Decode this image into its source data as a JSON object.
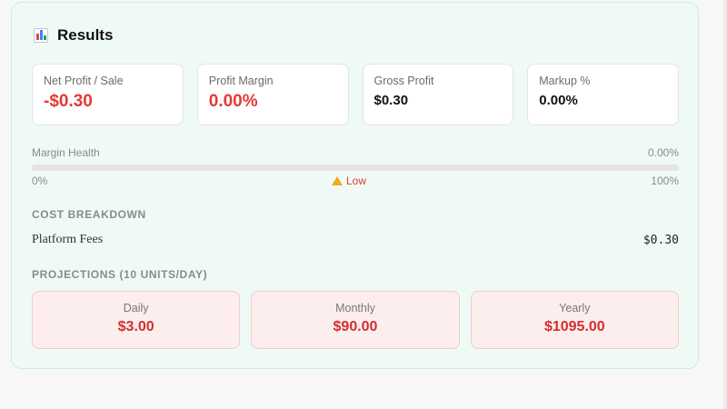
{
  "results": {
    "title": "Results",
    "header_icon": "bar-chart-icon"
  },
  "metrics": [
    {
      "label": "Net Profit / Sale",
      "value": "-$0.30"
    },
    {
      "label": "Profit Margin",
      "value": "0.00%"
    },
    {
      "label": "Gross Profit",
      "value": "$0.30"
    },
    {
      "label": "Markup %",
      "value": "0.00%"
    }
  ],
  "margin_health": {
    "label": "Margin Health",
    "value": "0.00%",
    "fill_percent": 0,
    "min_label": "0%",
    "max_label": "100%",
    "status": "Low",
    "status_icon": "warning-icon",
    "status_color": "#e53935"
  },
  "cost_breakdown": {
    "title": "COST BREAKDOWN",
    "items": [
      {
        "name": "Platform Fees",
        "value": "$0.30"
      }
    ]
  },
  "projections": {
    "title": "PROJECTIONS (10 UNITS/DAY)",
    "items": [
      {
        "label": "Daily",
        "value": "$3.00"
      },
      {
        "label": "Monthly",
        "value": "$90.00"
      },
      {
        "label": "Yearly",
        "value": "$1095.00"
      }
    ]
  },
  "colors": {
    "panel_bg": "#effaf6",
    "negative": "#e53935",
    "projection_bg": "#fdeeee"
  }
}
